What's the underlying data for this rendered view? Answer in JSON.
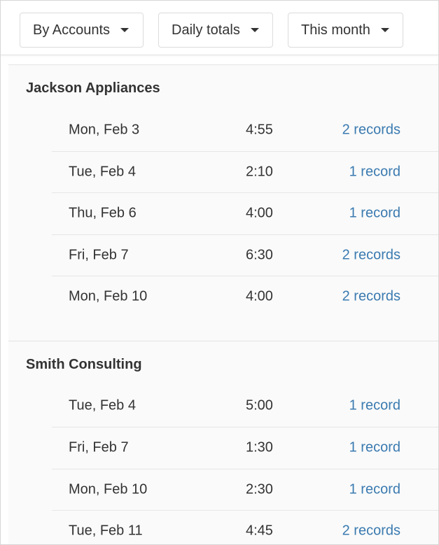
{
  "filters": {
    "grouping": "By Accounts",
    "totals": "Daily totals",
    "period": "This month"
  },
  "groups": [
    {
      "title": "Jackson Appliances",
      "rows": [
        {
          "date": "Mon, Feb 3",
          "total": "4:55",
          "records": "2 records"
        },
        {
          "date": "Tue, Feb 4",
          "total": "2:10",
          "records": "1 record"
        },
        {
          "date": "Thu, Feb 6",
          "total": "4:00",
          "records": "1 record"
        },
        {
          "date": "Fri, Feb 7",
          "total": "6:30",
          "records": "2 records"
        },
        {
          "date": "Mon, Feb 10",
          "total": "4:00",
          "records": "2 records"
        }
      ]
    },
    {
      "title": "Smith Consulting",
      "rows": [
        {
          "date": "Tue, Feb 4",
          "total": "5:00",
          "records": "1 record"
        },
        {
          "date": "Fri, Feb 7",
          "total": "1:30",
          "records": "1 record"
        },
        {
          "date": "Mon, Feb 10",
          "total": "2:30",
          "records": "1 record"
        },
        {
          "date": "Tue, Feb 11",
          "total": "4:45",
          "records": "2 records"
        }
      ]
    }
  ],
  "colors": {
    "link": "#3a7ab0",
    "text": "#333333",
    "list_background": "#fafafa"
  },
  "icons": {
    "dropdown": "caret-down-icon"
  }
}
